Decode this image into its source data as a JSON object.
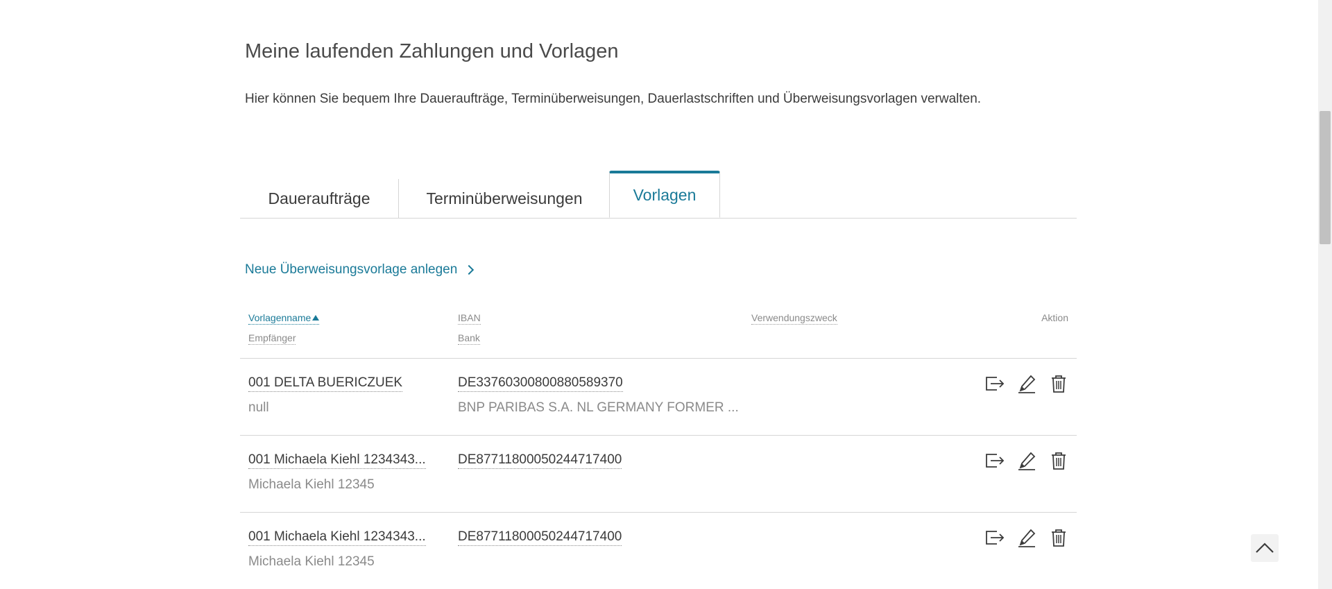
{
  "page": {
    "title": "Meine laufenden Zahlungen und Vorlagen",
    "intro": "Hier können Sie bequem Ihre Daueraufträge, Terminüberweisungen, Dauerlastschriften und Überweisungsvorlagen verwalten."
  },
  "tabs": [
    {
      "label": "Daueraufträge",
      "active": false
    },
    {
      "label": "Terminüberweisungen",
      "active": false
    },
    {
      "label": "Vorlagen",
      "active": true
    }
  ],
  "new_template_link": "Neue Überweisungsvorlage anlegen",
  "table": {
    "headers": {
      "name": "Vorlagenname",
      "recipient": "Empfänger",
      "iban": "IBAN",
      "bank": "Bank",
      "purpose": "Verwendungszweck",
      "action": "Aktion"
    },
    "rows": [
      {
        "name": "001 DELTA BUERICZUEK",
        "recipient": "null",
        "iban": "DE33760300800880589370",
        "bank": "BNP PARIBAS S.A. NL GERMANY FORMER ..."
      },
      {
        "name": "001 Michaela Kiehl 1234343...",
        "recipient": "Michaela Kiehl 12345",
        "iban": "DE87711800050244717400",
        "bank": ""
      },
      {
        "name": "001 Michaela Kiehl 1234343...",
        "recipient": "Michaela Kiehl 12345",
        "iban": "DE87711800050244717400",
        "bank": ""
      }
    ]
  },
  "colors": {
    "accent": "#1a7a98",
    "text": "#3b3b3b",
    "muted": "#8a8a8a",
    "border": "#d5d5d5"
  },
  "icons": {
    "execute": "transfer-out-icon",
    "edit": "pencil-icon",
    "delete": "trash-icon",
    "sort": "sort-ascending-icon",
    "scroll_top": "chevron-up-icon"
  }
}
